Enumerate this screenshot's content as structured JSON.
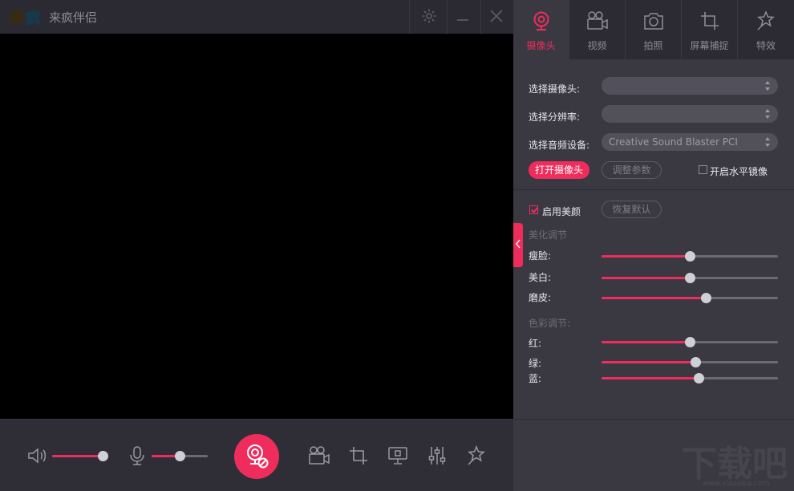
{
  "titlebar": {
    "logo_text": "来疯",
    "app_title": "来疯伴侣"
  },
  "tabs": [
    {
      "label": "摄像头",
      "icon": "webcam-icon",
      "active": true
    },
    {
      "label": "视频",
      "icon": "video-camera-icon",
      "active": false
    },
    {
      "label": "拍照",
      "icon": "photo-camera-icon",
      "active": false
    },
    {
      "label": "屏幕捕捉",
      "icon": "crop-icon",
      "active": false
    },
    {
      "label": "特效",
      "icon": "magic-wand-icon",
      "active": false
    }
  ],
  "camera": {
    "select_camera_label": "选择摄像头:",
    "select_camera_value": "",
    "resolution_label": "选择分辨率:",
    "resolution_value": "",
    "audio_device_label": "选择音频设备:",
    "audio_device_value": "Creative Sound Blaster PCI",
    "open_camera_button": "打开摄像头",
    "adjust_params_button": "调整参数",
    "mirror_label": "开启水平镜像",
    "mirror_checked": false
  },
  "beauty": {
    "enable_label": "启用美颜",
    "enable_checked": true,
    "restore_default_button": "恢复默认",
    "beautify_section": "美化调节",
    "slim_face_label": "瘦脸:",
    "slim_face_value": 0.5,
    "whiten_label": "美白:",
    "whiten_value": 0.5,
    "smooth_skin_label": "磨皮:",
    "smooth_skin_value": 0.59,
    "color_section": "色彩调节:",
    "red_label": "红:",
    "red_value": 0.5,
    "green_label": "绿:",
    "green_value": 0.53,
    "blue_label": "蓝:",
    "blue_value": 0.55
  },
  "bottombar": {
    "speaker_volume": 1.0,
    "mic_volume": 0.5
  },
  "watermark": {
    "logo_text": "下载吧",
    "url": "www.xiazaiba.com"
  },
  "colors": {
    "accent": "#ee2d5d",
    "panel": "#3a3942",
    "background": "#2b2a33"
  }
}
